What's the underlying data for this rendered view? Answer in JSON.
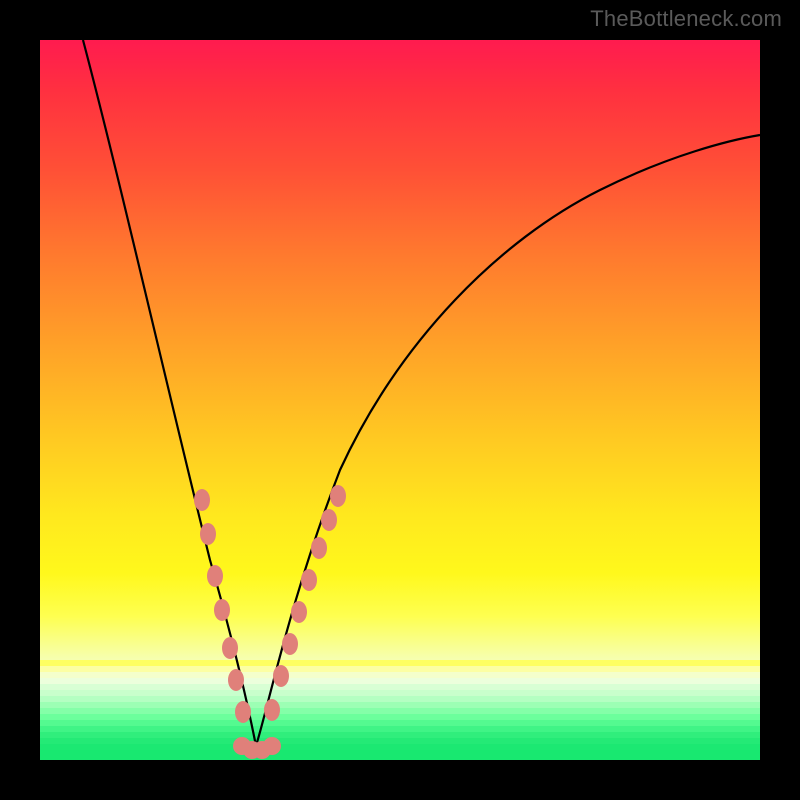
{
  "watermark": "TheBottleneck.com",
  "chart_data": {
    "type": "line",
    "title": "",
    "xlabel": "",
    "ylabel": "",
    "xlim": [
      0,
      100
    ],
    "ylim": [
      0,
      100
    ],
    "grid": false,
    "series": [
      {
        "name": "curve-left",
        "x": [
          6,
          8,
          10,
          12,
          14,
          16,
          18,
          20,
          22,
          24,
          26,
          27,
          28,
          29,
          30
        ],
        "values": [
          100,
          86,
          72,
          60,
          50,
          41,
          33,
          27,
          21,
          15,
          9,
          7,
          5,
          3,
          2
        ]
      },
      {
        "name": "curve-right",
        "x": [
          30,
          32,
          34,
          36,
          38,
          40,
          44,
          48,
          52,
          56,
          60,
          66,
          72,
          78,
          84,
          90,
          96,
          100
        ],
        "values": [
          2,
          3,
          6,
          10,
          15,
          20,
          30,
          39,
          47,
          53,
          58,
          65,
          70,
          74,
          78,
          81,
          84,
          86
        ]
      },
      {
        "name": "dots-left",
        "type": "scatter",
        "x": [
          22,
          23,
          25,
          26,
          27,
          28,
          29,
          30
        ],
        "values": [
          36,
          31,
          23,
          18,
          13,
          9,
          5,
          2
        ]
      },
      {
        "name": "dots-right",
        "type": "scatter",
        "x": [
          31,
          32,
          33,
          34,
          35,
          36,
          37,
          38,
          39
        ],
        "values": [
          3,
          6,
          9,
          13,
          18,
          23,
          28,
          32,
          36
        ]
      },
      {
        "name": "dots-bottom",
        "type": "scatter",
        "x": [
          28,
          29,
          30,
          31,
          32
        ],
        "values": [
          1,
          1,
          1,
          1,
          1
        ]
      }
    ],
    "colors": {
      "curve": "#000000",
      "dots": "#e0807a"
    },
    "gradient_stops": [
      {
        "pos": 0,
        "color": "#ff1b4f"
      },
      {
        "pos": 7,
        "color": "#ff3040"
      },
      {
        "pos": 18,
        "color": "#ff5036"
      },
      {
        "pos": 30,
        "color": "#ff7a2e"
      },
      {
        "pos": 42,
        "color": "#ffa028"
      },
      {
        "pos": 55,
        "color": "#ffc822"
      },
      {
        "pos": 66,
        "color": "#ffe81e"
      },
      {
        "pos": 74,
        "color": "#fff81c"
      },
      {
        "pos": 80,
        "color": "#feff50"
      },
      {
        "pos": 86,
        "color": "#f6ffb0"
      },
      {
        "pos": 90,
        "color": "#e0ffc8"
      },
      {
        "pos": 94,
        "color": "#98ffb0"
      },
      {
        "pos": 97,
        "color": "#38f080"
      },
      {
        "pos": 100,
        "color": "#18e870"
      }
    ]
  }
}
